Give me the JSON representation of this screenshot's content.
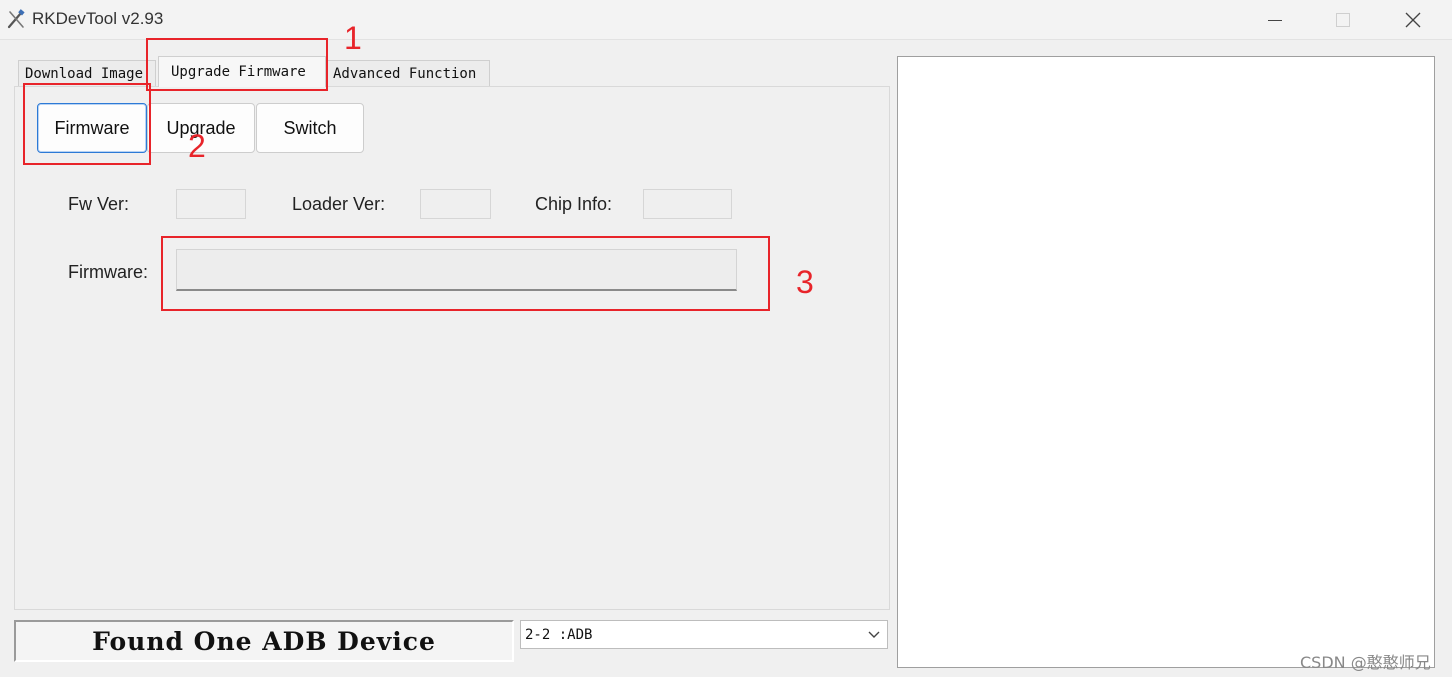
{
  "window": {
    "title": "RKDevTool v2.93",
    "icons": [
      "tools-icon",
      "minimize-icon",
      "maximize-icon",
      "close-icon"
    ]
  },
  "tabs": [
    {
      "label": "Download Image",
      "active": false
    },
    {
      "label": "Upgrade Firmware",
      "active": true
    },
    {
      "label": "Advanced Function",
      "active": false
    }
  ],
  "buttons": {
    "firmware": "Firmware",
    "upgrade": "Upgrade",
    "switch": "Switch"
  },
  "fields": {
    "fw_ver_label": "Fw Ver:",
    "fw_ver_value": "",
    "loader_ver_label": "Loader Ver:",
    "loader_ver_value": "",
    "chip_info_label": "Chip Info:",
    "chip_info_value": "",
    "firmware_label": "Firmware:",
    "firmware_value": ""
  },
  "annotations": [
    "1",
    "2",
    "3"
  ],
  "status": {
    "message": "Found One ADB Device",
    "device_selected": "2-2 :ADB"
  },
  "watermark": "CSDN @憨憨师兄",
  "colors": {
    "annotation": "#e8242a",
    "focus_border": "#2d7ad6",
    "background": "#f0f0f0"
  }
}
